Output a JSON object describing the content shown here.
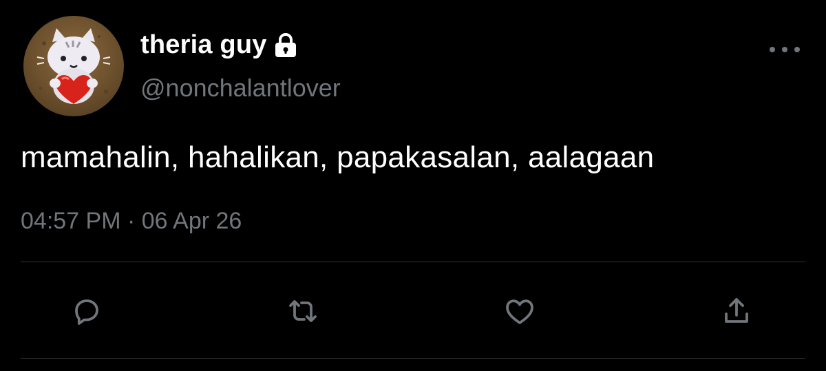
{
  "tweet": {
    "display_name": "theria guy",
    "handle": "@nonchalantlover",
    "text": "mamahalin, hahalikan, papakasalan, aalagaan",
    "time": "04:57 PM",
    "separator": " · ",
    "date": "06 Apr 26",
    "protected_icon": "lock-icon",
    "avatar": "avatar-cat-holding-heart"
  },
  "actions": {
    "reply_icon": "reply-icon",
    "retweet_icon": "retweet-icon",
    "like_icon": "heart-icon",
    "share_icon": "share-icon",
    "more_icon": "more-dots-icon"
  },
  "colors": {
    "background": "#000000",
    "primary_text": "#ffffff",
    "secondary_text": "#71767b",
    "divider": "#2f3336",
    "icon": "#71767b"
  }
}
